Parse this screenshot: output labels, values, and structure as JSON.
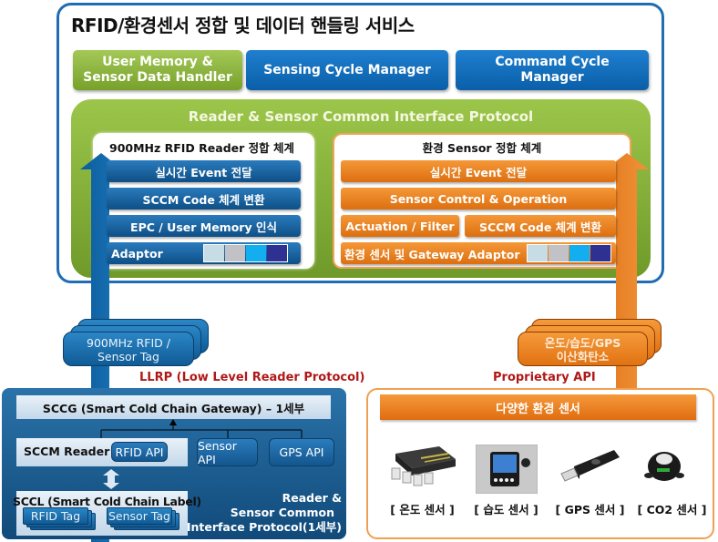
{
  "service": {
    "title": "RFID/환경센서 정합 및 데이터 핸들링 서비스",
    "buttons": [
      {
        "label_line1": "User Memory &",
        "label_line2": "Sensor Data Handler",
        "color": "#8cb43f"
      },
      {
        "label_line1": "Sensing Cycle Manager",
        "label_line2": "",
        "color": "#1473c2"
      },
      {
        "label_line1": "Command Cycle",
        "label_line2": "Manager",
        "color": "#1473c2"
      }
    ]
  },
  "protocol": {
    "title": "Reader & Sensor Common Interface Protocol",
    "rfid": {
      "title": "900MHz  RFID Reader 정합 체계",
      "layers": [
        "실시간 Event 전달",
        "SCCM Code 체계 변환",
        "EPC / User Memory 인식"
      ],
      "adaptor_label": "Adaptor",
      "swatches": [
        "#c6dde6",
        "#c2c2c6",
        "#12aef0",
        "#2e3192"
      ]
    },
    "env": {
      "title": "환경 Sensor 정합 체계",
      "layers": [
        "실시간 Event 전달",
        "Sensor Control & Operation"
      ],
      "split_left": "Actuation / Filter",
      "split_right": "SCCM Code  체계 변환",
      "adaptor_label": "환경 센서 및 Gateway Adaptor",
      "swatches": [
        "#c6dde6",
        "#c2c2c6",
        "#12aef0",
        "#2e3192"
      ]
    }
  },
  "middle": {
    "rfid_tag_line1": "900MHz  RFID /",
    "rfid_tag_line2": "Sensor Tag",
    "env_tag_line1": "온도/습도/GPS",
    "env_tag_line2": "이산화탄소",
    "llrp_label": "LLRP (Low Level Reader Protocol)",
    "proprietary_label": "Proprietary API"
  },
  "llrp_panel": {
    "gateway": "SCCG (Smart Cold Chain Gateway) – 1세부",
    "reader": "SCCM  Reader",
    "rfid_api": "RFID API",
    "sensor_api": "Sensor API",
    "gps_api": "GPS  API",
    "label_title": "SCCL (Smart Cold Chain Label)",
    "rfid_tag": "RFID Tag",
    "sensor_tag": "Sensor Tag",
    "caption_line1": "Reader &",
    "caption_line2": "Sensor Common",
    "caption_line3": "Interface Protocol(1세부)"
  },
  "sensor_panel": {
    "header": "다양한 환경 센서",
    "sensors": [
      {
        "label": "[ 온도  센서 ]",
        "icon": "temperature-sensor-chip"
      },
      {
        "label": "[ 습도  센서 ]",
        "icon": "humidity-sensor-display"
      },
      {
        "label": "[ GPS  센서 ]",
        "icon": "gps-usb-dongle"
      },
      {
        "label": "[ CO2  센서 ]",
        "icon": "co2-sensor-puck"
      }
    ]
  }
}
